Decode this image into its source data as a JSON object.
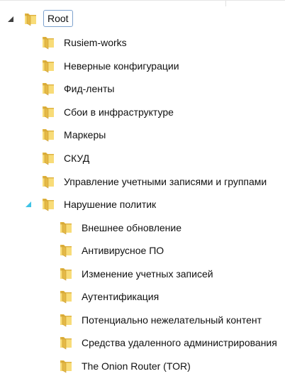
{
  "tree": {
    "root": {
      "label": "Root",
      "expanded": true,
      "selected": true
    },
    "level1": [
      {
        "label": "Rusiem-works"
      },
      {
        "label": "Неверные конфигурации"
      },
      {
        "label": "Фид-ленты"
      },
      {
        "label": "Сбои в инфраструктуре"
      },
      {
        "label": "Маркеры"
      },
      {
        "label": "СКУД"
      },
      {
        "label": "Управление учетными записями и группами"
      },
      {
        "label": "Нарушение политик",
        "expanded": true
      }
    ],
    "policy_children": [
      {
        "label": "Внешнее обновление"
      },
      {
        "label": "Антивирусное ПО"
      },
      {
        "label": "Изменение учетных записей"
      },
      {
        "label": "Аутентификация"
      },
      {
        "label": "Потенциально нежелательный контент"
      },
      {
        "label": "Средства удаленного администрирования"
      },
      {
        "label": "The Onion Router (TOR)"
      }
    ]
  },
  "colors": {
    "folder_light": "#f8dc78",
    "folder_dark": "#e2b540",
    "expander_root": "#404040",
    "expander_policy": "#3fc3e6",
    "selection_border": "#7da2ce"
  },
  "icons": {
    "folder": "folder-icon",
    "expanded": "expanded-triangle-icon"
  }
}
